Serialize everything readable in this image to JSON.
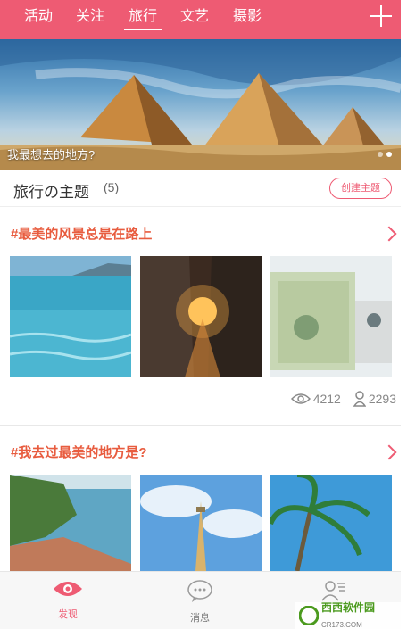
{
  "nav": {
    "tabs": [
      {
        "label": "活动"
      },
      {
        "label": "关注"
      },
      {
        "label": "旅行"
      },
      {
        "label": "文艺"
      },
      {
        "label": "摄影"
      }
    ],
    "active_tab": "旅行"
  },
  "banner": {
    "caption": "我最想去的地方?",
    "page_count": 2,
    "current_page": 2
  },
  "section": {
    "title": "旅行の主题",
    "count": "(5)",
    "create_label": "创建主题"
  },
  "topics": [
    {
      "title": "#最美的风景总是在路上",
      "views": "4212",
      "participants": "2293"
    },
    {
      "title": "#我去过最美的地方是?"
    }
  ],
  "bottom_bar": {
    "items": [
      {
        "label": "发现",
        "icon": "eye-icon"
      },
      {
        "label": "消息",
        "icon": "chat-bubble-icon"
      },
      {
        "label": "",
        "icon": "user-list-icon"
      }
    ]
  },
  "watermark": {
    "text": "西西软件园",
    "sub": "CR173.COM"
  },
  "colors": {
    "brand": "#ee5b73",
    "topic_title": "#e85c3f",
    "muted": "#888888"
  }
}
